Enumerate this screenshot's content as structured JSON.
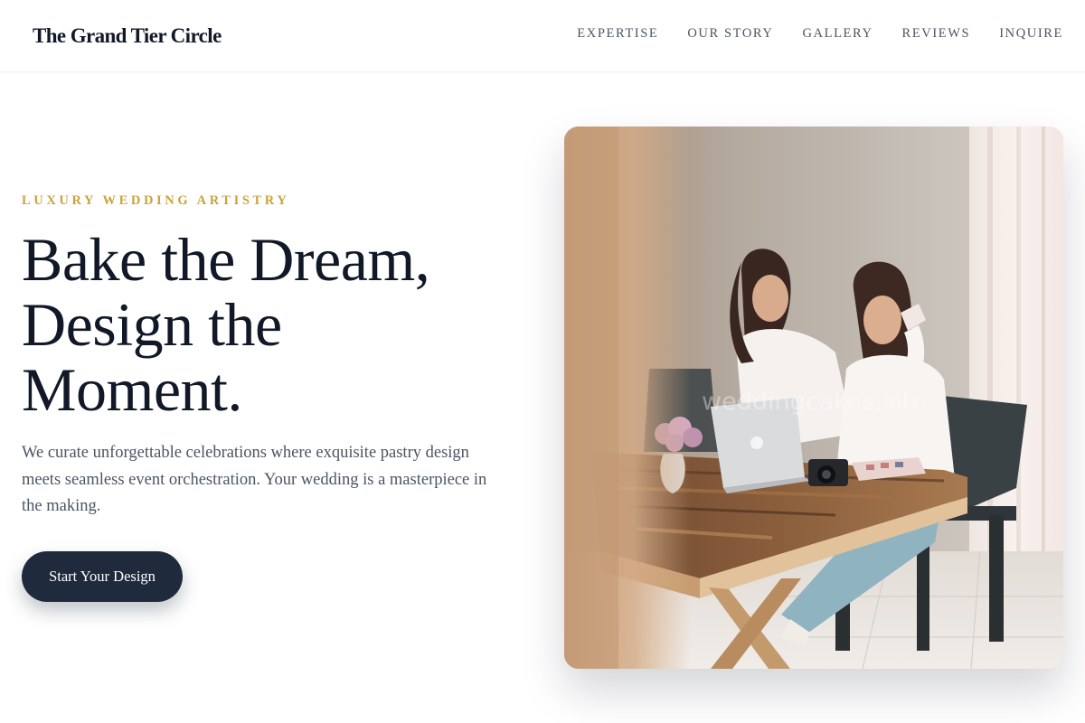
{
  "header": {
    "brand": "The Grand Tier Circle",
    "nav": [
      {
        "label": "EXPERTISE"
      },
      {
        "label": "OUR STORY"
      },
      {
        "label": "GALLERY"
      },
      {
        "label": "REVIEWS"
      },
      {
        "label": "INQUIRE"
      }
    ]
  },
  "hero": {
    "eyebrow": "LUXURY WEDDING ARTISTRY",
    "headline_lines": [
      "Bake the Dream,",
      "Design the",
      "Moment."
    ],
    "lede": "We curate unforgettable celebrations where exquisite pastry design meets seamless event orchestration. Your wedding is a masterpiece in the making.",
    "cta_label": "Start Your Design",
    "photo": {
      "watermark": "weddingcakes.site"
    }
  },
  "colors": {
    "accent_gold": "#c9a43a",
    "cta_navy": "#1f2a3d",
    "text_dark": "#111827",
    "text_muted": "#4b5563"
  }
}
